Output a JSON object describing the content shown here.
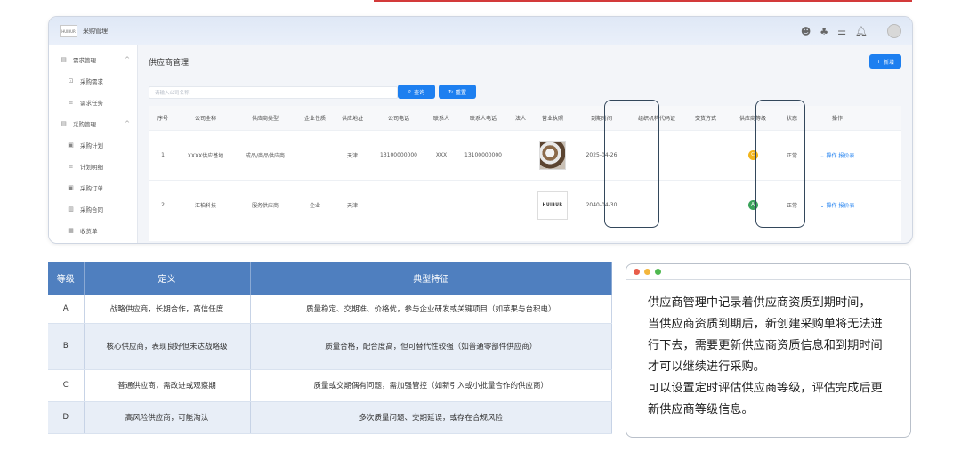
{
  "app": {
    "logo_text": "HUIBUR",
    "title": "采购管理",
    "header_icons": [
      "robot-icon",
      "user-switch-icon",
      "list-icon",
      "bell-icon"
    ]
  },
  "sidebar": {
    "groups": [
      {
        "label": "需求管理",
        "icon": "doc-icon",
        "items": [
          {
            "label": "采购需求",
            "icon": "cart-icon"
          },
          {
            "label": "需求任务",
            "icon": "task-icon"
          }
        ]
      },
      {
        "label": "采购管理",
        "icon": "doc-icon",
        "items": [
          {
            "label": "采购计划",
            "icon": "plan-icon"
          },
          {
            "label": "计划明细",
            "icon": "list-icon"
          },
          {
            "label": "采购订单",
            "icon": "order-icon"
          },
          {
            "label": "采购合同",
            "icon": "contract-icon"
          },
          {
            "label": "收货单",
            "icon": "receipt-icon"
          }
        ]
      }
    ]
  },
  "main": {
    "page_title": "供应商管理",
    "new_button": "新增",
    "search_placeholder": "请输入公司名称",
    "query_button": "查询",
    "reset_button": "重置",
    "columns": [
      "序号",
      "公司全称",
      "供应商类型",
      "企业性质",
      "供应地址",
      "公司电话",
      "联系人",
      "联系人电话",
      "法人",
      "营业执照",
      "到期时间",
      "组织机构代码证",
      "交货方式",
      "供应商等级",
      "状态",
      "操作"
    ],
    "rows": [
      {
        "index": "1",
        "company": "XXXX供应基地",
        "type": "成品/商品供应商",
        "nature": "",
        "address": "天津",
        "phone": "13100000000",
        "contact": "XXX",
        "contact_phone": "13100000000",
        "legal": "",
        "license": "image",
        "expire": "2025-04-26",
        "org_code": "",
        "delivery": "",
        "grade": "C",
        "grade_color": "#f2b51c",
        "status": "正常",
        "op1": "操作",
        "op2": "报价表"
      },
      {
        "index": "2",
        "company": "汇柏科技",
        "type": "服务供应商",
        "nature": "企业",
        "address": "天津",
        "phone": "",
        "contact": "",
        "contact_phone": "",
        "legal": "",
        "license": "HUIBUR",
        "expire": "2040-04-30",
        "org_code": "",
        "delivery": "",
        "grade": "A",
        "grade_color": "#3aa35a",
        "status": "正常",
        "op1": "操作",
        "op2": "报价表"
      }
    ]
  },
  "grade_table": {
    "headers": [
      "等级",
      "定义",
      "典型特征"
    ],
    "rows": [
      {
        "grade": "A",
        "definition": "战略供应商，长期合作，高信任度",
        "feature": "质量稳定、交期准、价格优，参与企业研发或关键项目（如苹果与台积电）"
      },
      {
        "grade": "B",
        "definition": "核心供应商，表现良好但未达战略级",
        "feature": "质量合格，配合度高，但可替代性较强（如普通零部件供应商）"
      },
      {
        "grade": "C",
        "definition": "普通供应商，需改进或观察期",
        "feature": "质量或交期偶有问题，需加强管控（如新引入或小批量合作的供应商）"
      },
      {
        "grade": "D",
        "definition": "高风险供应商，可能淘汰",
        "feature": "多次质量问题、交期延误，或存在合规风险"
      }
    ]
  },
  "note": {
    "dots": [
      "#e85d4a",
      "#f3b63c",
      "#4fb84f"
    ],
    "lines": [
      "供应商管理中记录着供应商资质到期时间，",
      "当供应商资质到期后，新创建采购单将无法进",
      "行下去，需要更新供应商资质信息和到期时间",
      "才可以继续进行采购。",
      "可以设置定时评估供应商等级，评估完成后更",
      "新供应商等级信息。"
    ]
  }
}
